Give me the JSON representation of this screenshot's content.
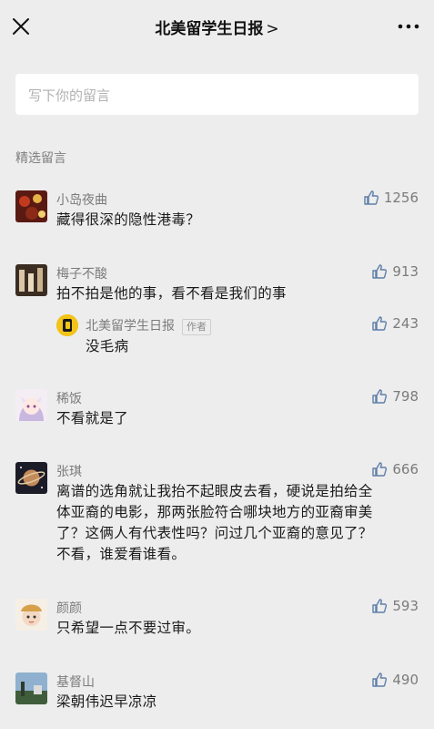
{
  "header": {
    "title": "北美留学生日报",
    "title_chevron": ">",
    "close_icon": "close-icon",
    "more_icon": "more-icon"
  },
  "input": {
    "placeholder": "写下你的留言"
  },
  "section_label": "精选留言",
  "colors": {
    "background": "#ededed",
    "like_icon": "#5e7ea8",
    "author_avatar": "#f2c418"
  },
  "comments": [
    {
      "name": "小岛夜曲",
      "likes": "1256",
      "text": "藏得很深的隐性港毒？"
    },
    {
      "name": "梅子不酸",
      "likes": "913",
      "text": "拍不拍是他的事，看不看是我们的事",
      "reply": {
        "name": "北美留学生日报",
        "tag": "作者",
        "likes": "243",
        "text": "没毛病"
      }
    },
    {
      "name": "稀饭",
      "likes": "798",
      "text": "不看就是了"
    },
    {
      "name": "张琪",
      "likes": "666",
      "lines": [
        "离谱的选角就让我抬不起眼皮去看，硬说是拍给全",
        "体亚裔的电影，那两张脸符合哪块地方的亚裔审美",
        "了？这俩人有代表性吗？问过几个亚裔的意见了？",
        "不看，谁爱看谁看。"
      ]
    },
    {
      "name": "颜颜",
      "likes": "593",
      "text": "只希望一点不要过审。"
    },
    {
      "name": "基督山",
      "likes": "490",
      "text": "梁朝伟迟早凉凉"
    }
  ]
}
